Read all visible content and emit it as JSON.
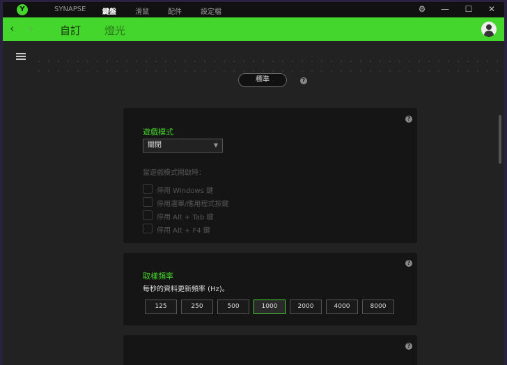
{
  "titlebar": {
    "logo": "razer-logo",
    "nav": [
      "SYNAPSE",
      "鍵盤",
      "滑鼠",
      "配件",
      "設定檔"
    ],
    "active": "鍵盤"
  },
  "subnav": {
    "back": "‹",
    "forward": "›",
    "tabs": [
      "自訂",
      "燈光"
    ],
    "active": "自訂"
  },
  "profile": {
    "label": "標準"
  },
  "game_mode": {
    "title": "遊戲模式",
    "select_value": "關閉",
    "when_on": "當遊戲模式開啟時：",
    "options": [
      {
        "label": "停用 Windows 鍵",
        "checked": false
      },
      {
        "label": "停用選單/應用程式按鍵",
        "checked": false
      },
      {
        "label": "停用 Alt + Tab 鍵",
        "checked": false
      },
      {
        "label": "停用 Alt + F4 鍵",
        "checked": false
      }
    ]
  },
  "polling": {
    "title": "取樣頻率",
    "desc": "每秒的資料更新頻率 (Hz)。",
    "rates": [
      "125",
      "250",
      "500",
      "1000",
      "2000",
      "4000",
      "8000"
    ],
    "selected": "1000"
  },
  "help": "?",
  "colors": {
    "accent": "#44d62c",
    "bg": "#222222",
    "card": "#151515"
  }
}
